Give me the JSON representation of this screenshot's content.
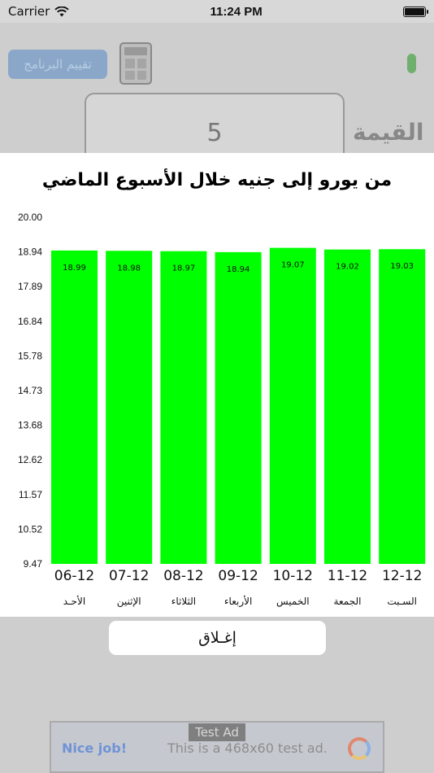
{
  "status_bar": {
    "carrier": "Carrier",
    "time": "11:24 PM"
  },
  "background": {
    "rate_button": "تقييم البرنامج",
    "value": "5",
    "value_label": "القيمة"
  },
  "modal": {
    "title": "من يورو إلى جنيه خلال الأسبوع الماضي",
    "close_label": "إغـلاق"
  },
  "ad": {
    "tag": "Test Ad",
    "nice": "Nice job!",
    "text": "This is a 468x60 test ad."
  },
  "colors": {
    "bar": "#00ff00",
    "overlay": "#cecece",
    "modal_bg": "#ffffff"
  },
  "chart_data": {
    "type": "bar",
    "categories": [
      "06-12",
      "07-12",
      "08-12",
      "09-12",
      "10-12",
      "11-12",
      "12-12"
    ],
    "day_names": [
      "الأحـد",
      "الإثنين",
      "الثلاثاء",
      "الأربعاء",
      "الخميس",
      "الجمعة",
      "السـبت"
    ],
    "values": [
      18.99,
      18.98,
      18.97,
      18.94,
      19.07,
      19.02,
      19.03
    ],
    "value_labels": [
      "18.99",
      "18.98",
      "18.97",
      "18.94",
      "19.07",
      "19.02",
      "19.03"
    ],
    "y_ticks": [
      "20.00",
      "18.94",
      "17.89",
      "16.84",
      "15.78",
      "14.73",
      "13.68",
      "12.62",
      "11.57",
      "10.52",
      "9.47"
    ],
    "ylim": [
      9.47,
      20.0
    ],
    "bar_color": "#00ff00",
    "grid": false,
    "title": "",
    "xlabel": "",
    "ylabel": ""
  }
}
